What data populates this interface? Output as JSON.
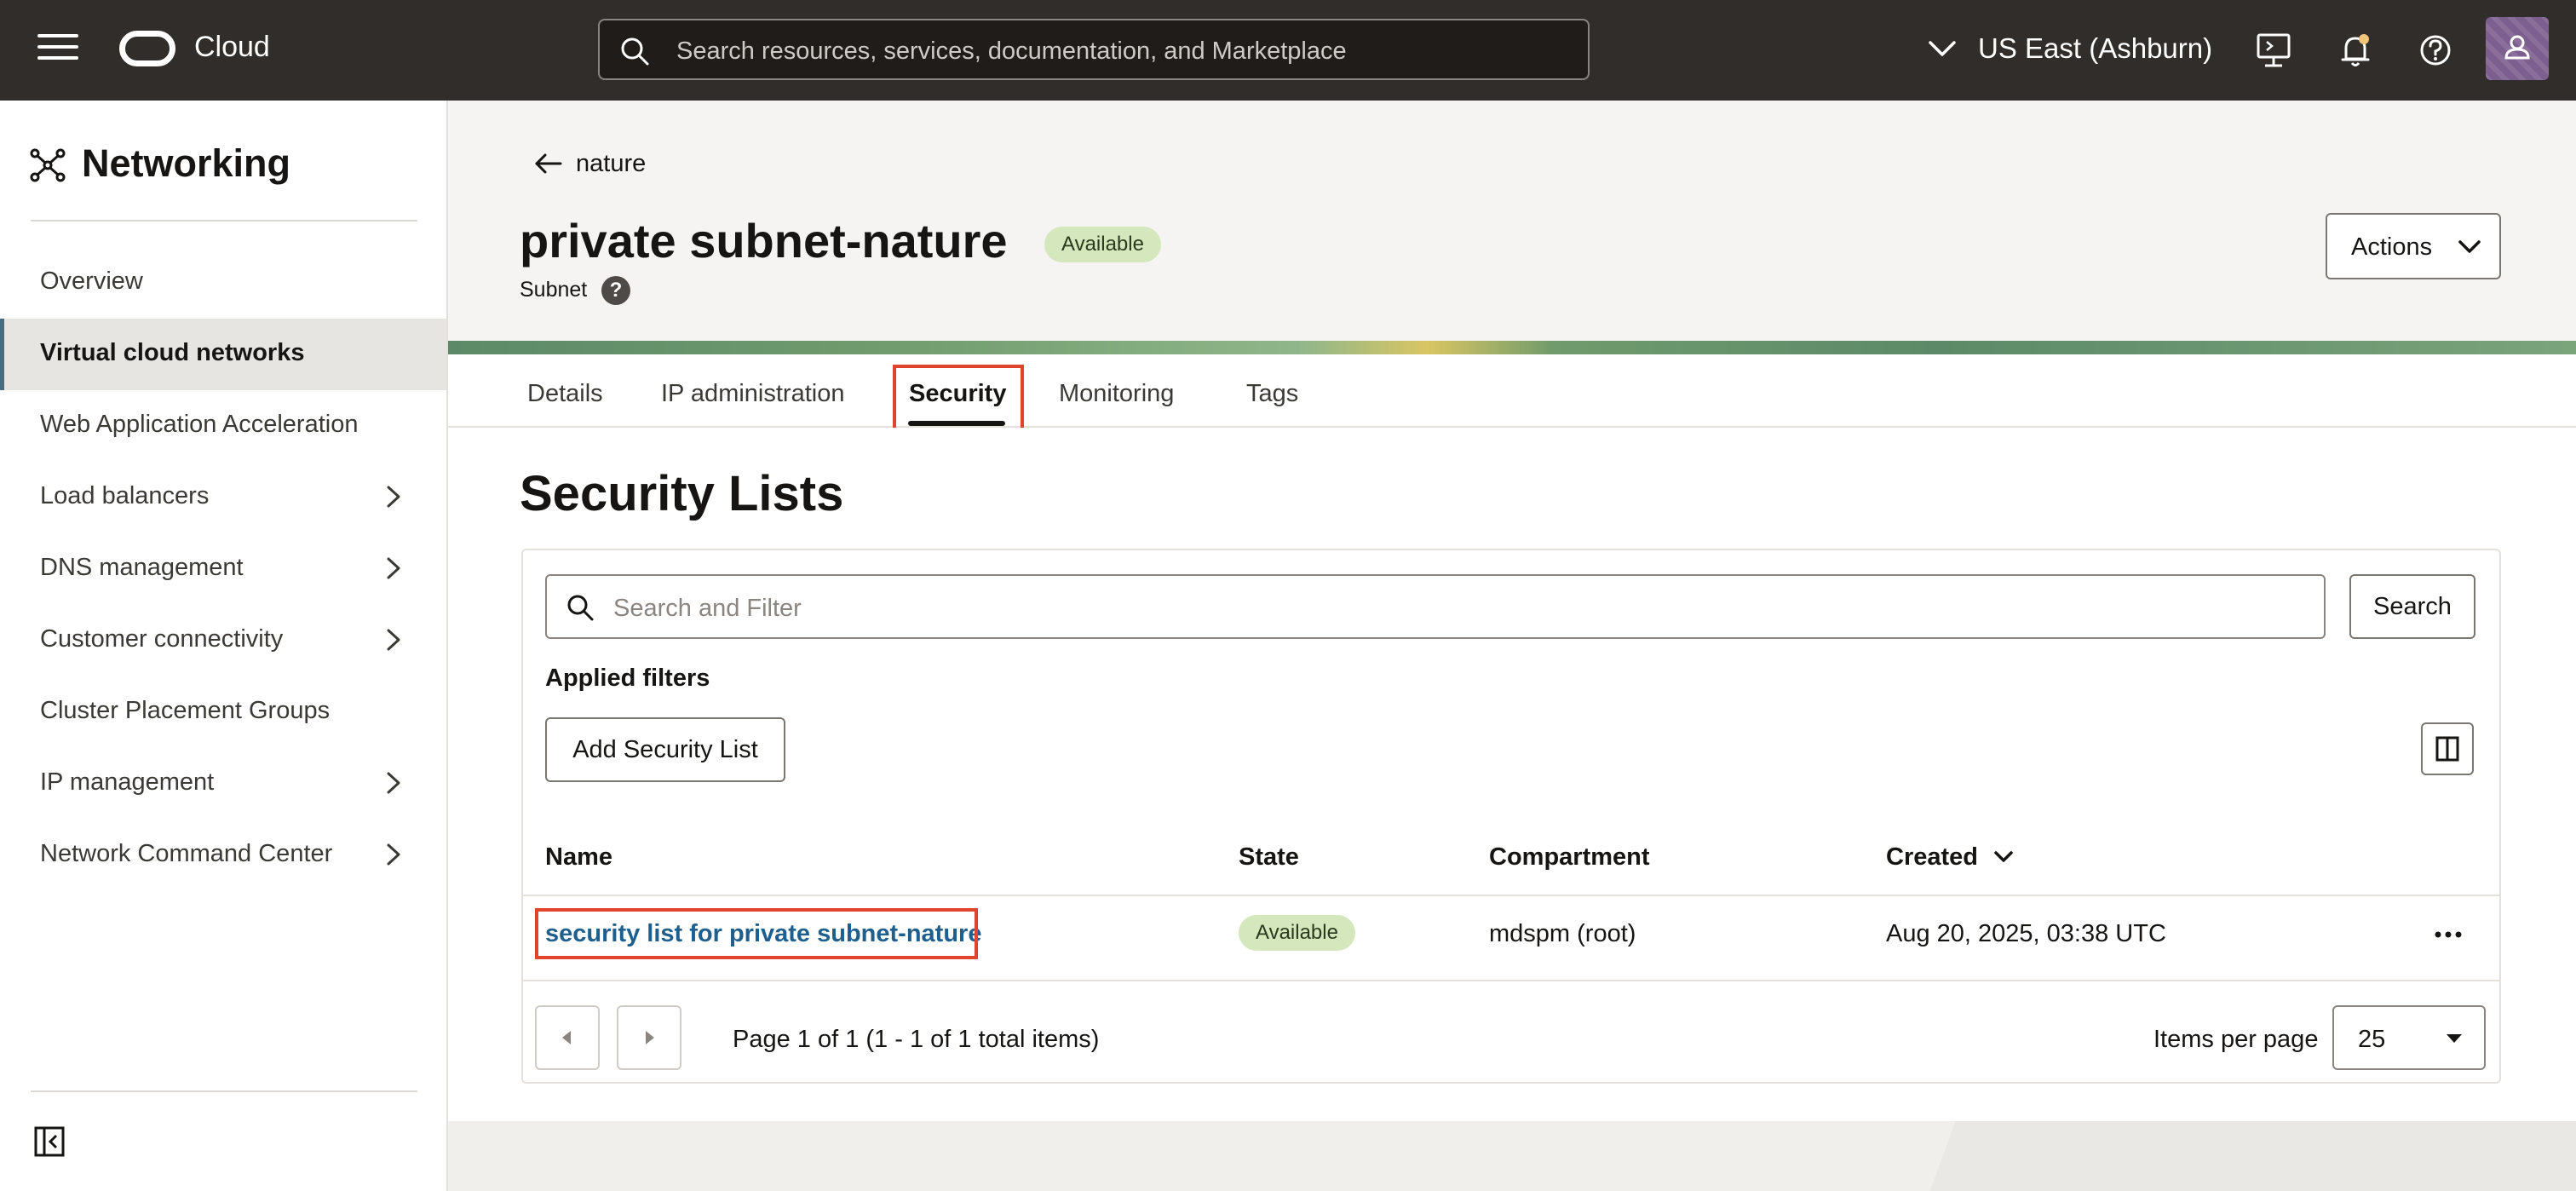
{
  "topbar": {
    "brand": "Cloud",
    "search_placeholder": "Search resources, services, documentation, and Marketplace",
    "region": "US East (Ashburn)"
  },
  "sidebar": {
    "title": "Networking",
    "items": [
      {
        "label": "Overview",
        "has_arrow": false,
        "active": false
      },
      {
        "label": "Virtual cloud networks",
        "has_arrow": false,
        "active": true
      },
      {
        "label": "Web Application Acceleration",
        "has_arrow": false,
        "active": false
      },
      {
        "label": "Load balancers",
        "has_arrow": true,
        "active": false
      },
      {
        "label": "DNS management",
        "has_arrow": true,
        "active": false
      },
      {
        "label": "Customer connectivity",
        "has_arrow": true,
        "active": false
      },
      {
        "label": "Cluster Placement Groups",
        "has_arrow": false,
        "active": false
      },
      {
        "label": "IP management",
        "has_arrow": true,
        "active": false
      },
      {
        "label": "Network Command Center",
        "has_arrow": true,
        "active": false
      }
    ]
  },
  "header": {
    "back_label": "nature",
    "title": "private subnet-nature",
    "status": "Available",
    "resource_type": "Subnet",
    "help_glyph": "?",
    "actions_label": "Actions"
  },
  "tabs": [
    {
      "label": "Details",
      "active": false
    },
    {
      "label": "IP administration",
      "active": false
    },
    {
      "label": "Security",
      "active": true
    },
    {
      "label": "Monitoring",
      "active": false
    },
    {
      "label": "Tags",
      "active": false
    }
  ],
  "security_lists": {
    "title": "Security Lists",
    "filter_placeholder": "Search and Filter",
    "search_button": "Search",
    "applied_filters_label": "Applied filters",
    "add_button": "Add Security List",
    "columns": {
      "name": "Name",
      "state": "State",
      "compartment": "Compartment",
      "created": "Created"
    },
    "rows": [
      {
        "name": "security list for private subnet-nature",
        "state": "Available",
        "compartment": "mdspm (root)",
        "created": "Aug 20, 2025, 03:38 UTC"
      }
    ],
    "pagination_text": "Page 1 of 1 (1 - 1 of 1 total items)",
    "items_per_page_label": "Items per page",
    "items_per_page_value": "25"
  },
  "colors": {
    "topbar_bg": "#312d2a",
    "link": "#1e5f8e",
    "badge_bg": "#d4e7bd",
    "highlight": "#e0442c"
  }
}
